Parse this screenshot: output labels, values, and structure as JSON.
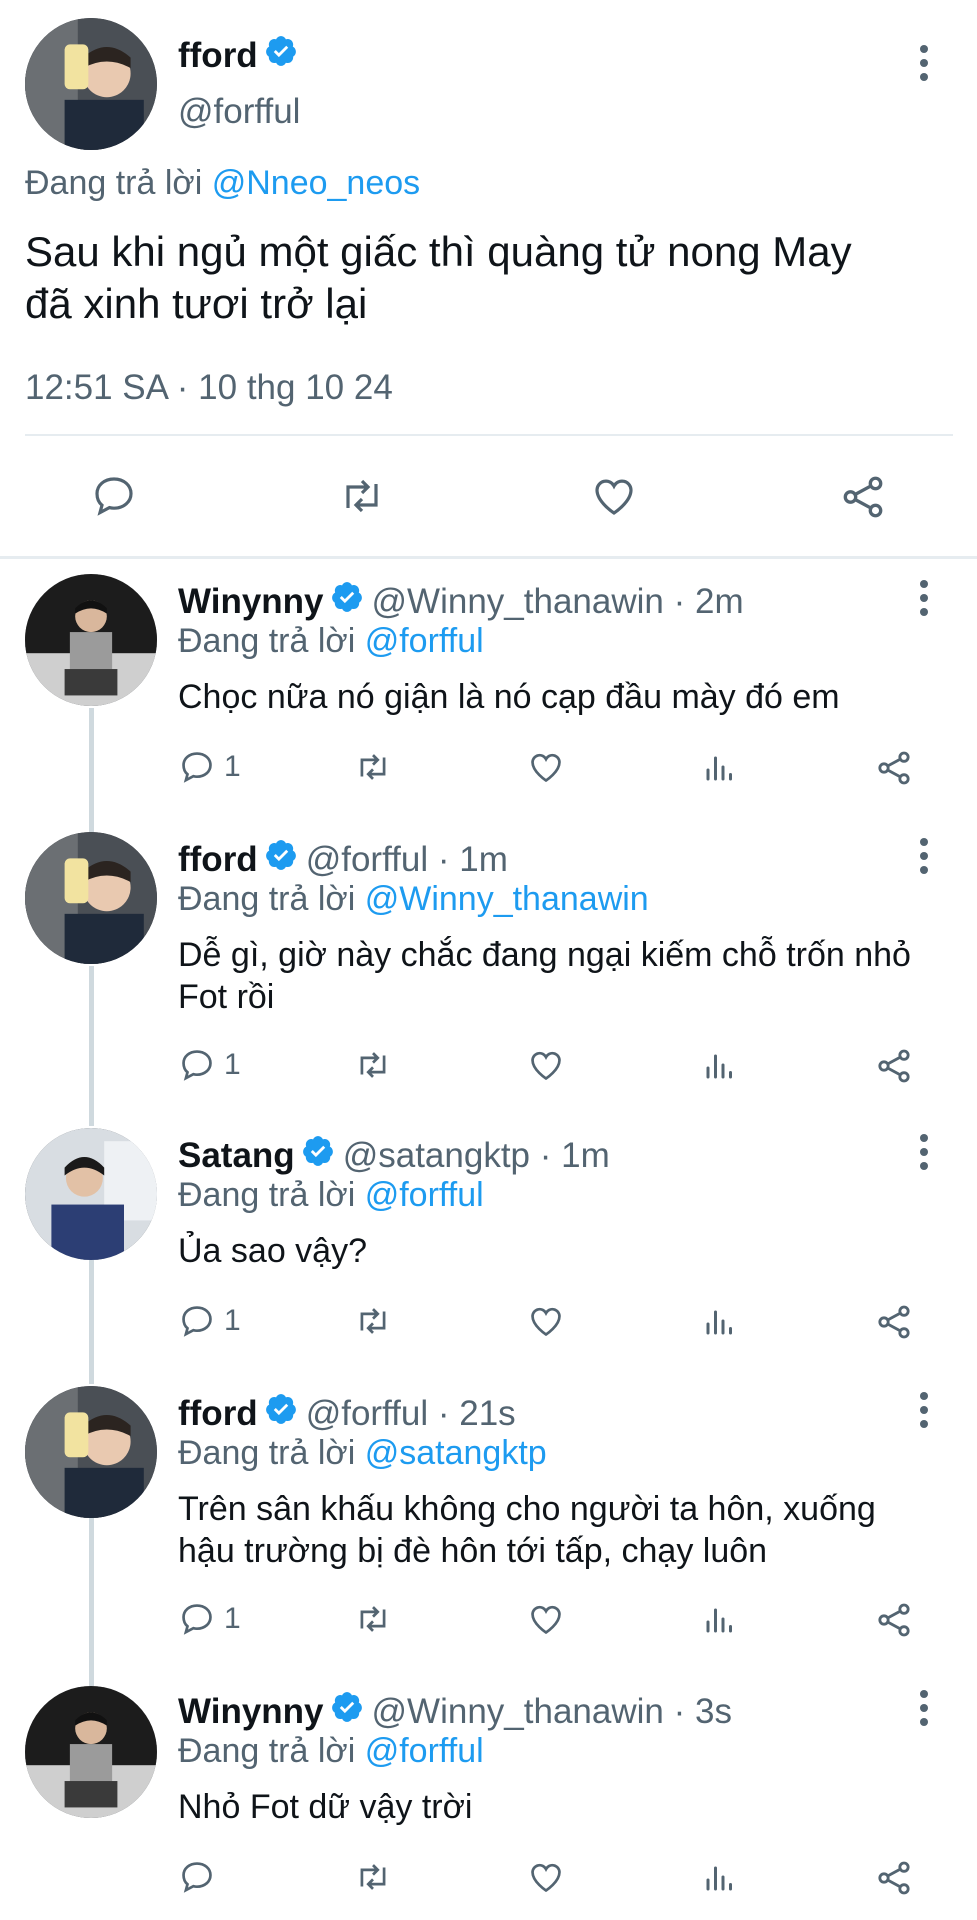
{
  "main_tweet": {
    "display_name": "fford",
    "handle": "@forfful",
    "replying_label": "Đang trả lời",
    "replying_to": "@Nneo_neos",
    "text_line1": "Sau khi ngủ một giấc thì quàng tử nong May",
    "text_line2": "đã xinh tươi trở lại",
    "timestamp": "12:51 SA · 10 thg 10 24"
  },
  "replies": [
    {
      "display_name": "Winynny",
      "handle_time": "@Winny_thanawin · 2m",
      "replying_label": "Đang trả lời",
      "replying_to": "@forfful",
      "text_line1": "Chọc nữa nó giận là nó cạp đầu mày đó em",
      "text_line2": "",
      "reply_count": "1"
    },
    {
      "display_name": "fford",
      "handle_time": "@forfful · 1m",
      "replying_label": "Đang trả lời",
      "replying_to": "@Winny_thanawin",
      "text_line1": "Dễ gì, giờ này chắc đang ngại kiếm chỗ trốn nhỏ",
      "text_line2": "Fot rồi",
      "reply_count": "1"
    },
    {
      "display_name": "Satang",
      "handle_time": "@satangktp · 1m",
      "replying_label": "Đang trả lời",
      "replying_to": "@forfful",
      "text_line1": "Ủa sao vậy?",
      "text_line2": "",
      "reply_count": "1"
    },
    {
      "display_name": "fford",
      "handle_time": "@forfful · 21s",
      "replying_label": "Đang trả lời",
      "replying_to": "@satangktp",
      "text_line1": "Trên sân khấu không cho người ta hôn, xuống",
      "text_line2": "hậu trường bị đè hôn tới tấp, chạy luôn",
      "reply_count": "1"
    },
    {
      "display_name": "Winynny",
      "handle_time": "@Winny_thanawin · 3s",
      "replying_label": "Đang trả lời",
      "replying_to": "@forfful",
      "text_line1": "Nhỏ Fot dữ vậy trời",
      "text_line2": "",
      "reply_count": ""
    }
  ],
  "icons": {
    "verified": "verified-badge-icon",
    "reply": "reply-icon",
    "retweet": "retweet-icon",
    "like": "heart-icon",
    "views": "views-icon",
    "share": "share-icon",
    "more": "more-icon"
  },
  "colors": {
    "accent": "#1d9bf0",
    "muted": "#536471",
    "text": "#0f1419"
  }
}
